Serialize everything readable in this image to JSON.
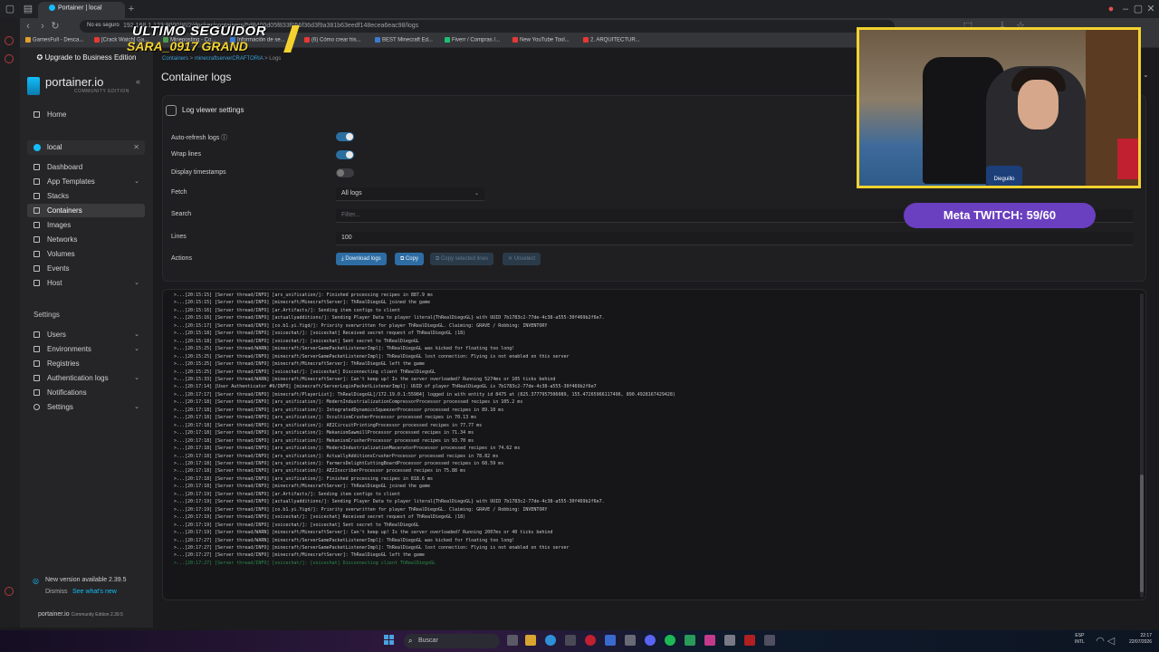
{
  "browser": {
    "tab_title": "Portainer | local",
    "url_security": "No es seguro",
    "url": "192.168.1.123:9000/#!/2/docker/containers/5d8400d05f833f056f36d3f9a381b63eedf148ecea6eac98/logs",
    "bookmarks": [
      "GamesFull - Desca...",
      "[Crack Watch] Ga...",
      "Mineposting - Co...",
      "Información de se...",
      "(6) Cómo crear his...",
      "BEST Minecraft Ed...",
      "Fiverr / Compras /...",
      "New YouTube Tool...",
      "2. ARQUITECTUR..."
    ]
  },
  "sidebar": {
    "upgrade_label": "Upgrade to Business Edition",
    "logo_name": "portainer.io",
    "logo_edition": "COMMUNITY EDITION",
    "home_label": "Home",
    "environment_name": "local",
    "env_items": [
      {
        "label": "Dashboard",
        "icon": "dashboard-icon",
        "chevron": false
      },
      {
        "label": "App Templates",
        "icon": "templates-icon",
        "chevron": true
      },
      {
        "label": "Stacks",
        "icon": "stacks-icon",
        "chevron": false
      },
      {
        "label": "Containers",
        "icon": "containers-icon",
        "chevron": false,
        "active": true
      },
      {
        "label": "Images",
        "icon": "images-icon",
        "chevron": false
      },
      {
        "label": "Networks",
        "icon": "networks-icon",
        "chevron": false
      },
      {
        "label": "Volumes",
        "icon": "volumes-icon",
        "chevron": false
      },
      {
        "label": "Events",
        "icon": "events-icon",
        "chevron": false
      },
      {
        "label": "Host",
        "icon": "host-icon",
        "chevron": true
      }
    ],
    "settings_heading": "Settings",
    "settings_items": [
      {
        "label": "Users",
        "chevron": true
      },
      {
        "label": "Environments",
        "chevron": true
      },
      {
        "label": "Registries",
        "chevron": false
      },
      {
        "label": "Authentication logs",
        "chevron": true
      },
      {
        "label": "Notifications",
        "chevron": false
      },
      {
        "label": "Settings",
        "chevron": true
      }
    ],
    "update_text": "New version available 2.39.5",
    "dismiss_label": "Dismiss",
    "whats_new_label": "See what's new",
    "footer_logo": "portainer.io",
    "footer_version": "Community Edition 2.39.5"
  },
  "main": {
    "breadcrumb": {
      "containers": "Containers",
      "container": "minecraftserverCRAFTORIA",
      "current": "Logs"
    },
    "page_title": "Container logs",
    "panel_title": "Log viewer settings",
    "auto_refresh_label": "Auto-refresh logs",
    "wrap_lines_label": "Wrap lines",
    "display_timestamps_label": "Display timestamps",
    "auto_refresh_on": true,
    "wrap_lines_on": true,
    "display_timestamps_on": false,
    "fetch_label": "Fetch",
    "fetch_value": "All logs",
    "search_label": "Search",
    "search_placeholder": "Filter...",
    "lines_label": "Lines",
    "lines_value": "100",
    "actions_label": "Actions",
    "download_label": "Download logs",
    "copy_label": "Copy",
    "copy_selected_label": "Copy selected lines",
    "unselect_label": "Unselect",
    "log_lines": [
      ">...[20:15:15] [Server thread/INFO] [ars_unification/]: Finished processing recipes in 887.9 ms",
      ">...[20:15:15] [Server thread/INFO] [minecraft/MinecraftServer]: ThRealDiegoGL joined the game",
      ">...[20:15:16] [Server thread/INFO] [ar.Artifacts/]: Sending item configs to client",
      ">...[20:15:16] [Server thread/INFO] [actuallyadditions/]: Sending Player Data to player literal{ThRealDiegoGL} with UUID 7b1783c2-77de-4c38-a555-30f469b2f6e7.",
      ">...[20:15:17] [Server thread/INFO] [co.b1.yi.Yigd/]: Priority overwritten for player ThRealDiegoGL. Claiming: GRAVE / Robbing: INVENTORY",
      ">...[20:15:18] [Server thread/INFO] [voicechat/]: [voicechat] Received secret request of ThRealDiegoGL (18)",
      ">...[20:15:18] [Server thread/INFO] [voicechat/]: [voicechat] Sent secret to ThRealDiegoGL",
      ">...[20:15:25] [Server thread/WARN] [minecraft/ServerGamePacketListenerImpl]: ThRealDiegoGL was kicked for floating too long!",
      ">...[20:15:25] [Server thread/INFO] [minecraft/ServerGamePacketListenerImpl]: ThRealDiegoGL lost connection: Flying is not enabled on this server",
      ">...[20:15:25] [Server thread/INFO] [minecraft/MinecraftServer]: ThRealDiegoGL left the game",
      ">...[20:15:25] [Server thread/INFO] [voicechat/]: [voicechat] Disconnecting client ThRealDiegoGL",
      ">...[20:15:33] [Server thread/WARN] [minecraft/MinecraftServer]: Can't keep up! Is the server overloaded? Running 5274ms or 105 ticks behind",
      ">...[20:17:14] [User Authenticator #9/INFO] [minecraft/ServerLoginPacketListenerImpl]: UUID of player ThRealDiegoGL is 7b1783c2-77de-4c38-a555-30f469b2f6e7",
      ">...[20:17:17] [Server thread/INFO] [minecraft/PlayerList]: ThRealDiegoGL[/172.19.0.1:55984] logged in with entity id 8475 at (825.3777957506089, 155.47265966117496, 890.4928167429428)",
      ">...[20:17:18] [Server thread/INFO] [ars_unification/]: ModernIndustrializationCompressorProcessor processed recipes in 105.2 ms",
      ">...[20:17:18] [Server thread/INFO] [ars_unification/]: IntegratedDynamicsSqueezerProcessor processed recipes in 89.10 ms",
      ">...[20:17:18] [Server thread/INFO] [ars_unification/]: OccultismCrusherProcessor processed recipes in 70.13 ms",
      ">...[20:17:18] [Server thread/INFO] [ars_unification/]: AE2CircuitPrintingProcessor processed recipes in 77.77 ms",
      ">...[20:17:18] [Server thread/INFO] [ars_unification/]: MekanismSawmillProcessor processed recipes in 71.34 ms",
      ">...[20:17:18] [Server thread/INFO] [ars_unification/]: MekanismCrusherProcessor processed recipes in 93.70 ms",
      ">...[20:17:18] [Server thread/INFO] [ars_unification/]: ModernIndustrializationMaceratorProcessor processed recipes in 74.62 ms",
      ">...[20:17:18] [Server thread/INFO] [ars_unification/]: ActuallyAdditionsCrusherProcessor processed recipes in 78.82 ms",
      ">...[20:17:18] [Server thread/INFO] [ars_unification/]: FarmersDelightCuttingBoardProcessor processed recipes in 68.59 ms",
      ">...[20:17:18] [Server thread/INFO] [ars_unification/]: AE2InscriberProcessor processed recipes in 75.88 ms",
      ">...[20:17:18] [Server thread/INFO] [ars_unification/]: Finished processing recipes in 818.6 ms",
      ">...[20:17:18] [Server thread/INFO] [minecraft/MinecraftServer]: ThRealDiegoGL joined the game",
      ">...[20:17:19] [Server thread/INFO] [ar.Artifacts/]: Sending item configs to client",
      ">...[20:17:19] [Server thread/INFO] [actuallyadditions/]: Sending Player Data to player literal{ThRealDiegoGL} with UUID 7b1783c2-77de-4c38-a555-30f469b2f6e7.",
      ">...[20:17:19] [Server thread/INFO] [co.b1.yi.Yigd/]: Priority overwritten for player ThRealDiegoGL. Claiming: GRAVE / Robbing: INVENTORY",
      ">...[20:17:19] [Server thread/INFO] [voicechat/]: [voicechat] Received secret request of ThRealDiegoGL (18)",
      ">...[20:17:19] [Server thread/INFO] [voicechat/]: [voicechat] Sent secret to ThRealDiegoGL",
      ">...[20:17:19] [Server thread/WARN] [minecraft/MinecraftServer]: Can't keep up! Is the server overloaded? Running 2007ms or 40 ticks behind",
      ">...[20:17:27] [Server thread/WARN] [minecraft/ServerGamePacketListenerImpl]: ThRealDiegoGL was kicked for floating too long!",
      ">...[20:17:27] [Server thread/INFO] [minecraft/ServerGamePacketListenerImpl]: ThRealDiegoGL lost connection: Flying is not enabled on this server",
      ">...[20:17:27] [Server thread/INFO] [minecraft/MinecraftServer]: ThRealDiegoGL left the game",
      ">...[20:17:27] [Server thread/INFO] [voicechat/]: [voicechat] Disconnecting client ThRealDiegoGL"
    ]
  },
  "overlay": {
    "last_follower_label": "ULTIMO SEGUIDOR",
    "last_follower_name": "SARA_0917 GRAND",
    "webcam_badge": "Dieguillo",
    "twitch_goal": "Meta TWITCH:  59/60"
  },
  "taskbar": {
    "search_label": "Buscar",
    "lang_top": "ESP",
    "lang_bottom": "INTL",
    "time": "22:17",
    "date": "22/07/2026"
  },
  "colors": {
    "accent": "#13bef9",
    "primary_button": "#2e6da4",
    "toggle_on": "#2b6fa0",
    "overlay_yellow": "#f3d230",
    "twitch_purple": "#6a3fc0"
  }
}
